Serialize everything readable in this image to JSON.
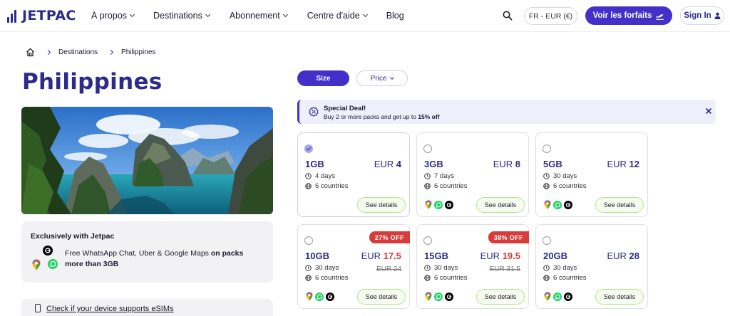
{
  "header": {
    "logo": "JETPAC",
    "nav": [
      {
        "label": "À propos",
        "dropdown": true
      },
      {
        "label": "Destinations",
        "dropdown": true
      },
      {
        "label": "Abonnement",
        "dropdown": true
      },
      {
        "label": "Centre d'aide",
        "dropdown": true
      },
      {
        "label": "Blog",
        "dropdown": false
      }
    ],
    "lang_currency": "FR - EUR (€)",
    "cta_label": "Voir les forfaits",
    "signin_label": "Sign In"
  },
  "breadcrumb": [
    "Destinations",
    "Philippines"
  ],
  "page_title": "Philippines",
  "exclusive": {
    "title": "Exclusively with Jetpac",
    "text_plain": "Free WhatsApp Chat, Uber & Google Maps ",
    "text_bold": "on packs more than 3GB"
  },
  "device_check": "Check if your device supports eSIMs",
  "filters": {
    "size": "Size",
    "price": "Price"
  },
  "deal": {
    "title": "Special Deal!",
    "text": "Buy 2 or more packs and get up to ",
    "highlight": "15% off"
  },
  "details_label": "See details",
  "plans": [
    {
      "data": "1GB",
      "currency": "EUR",
      "price": "4",
      "days": "4 days",
      "countries": "6 countries",
      "selected": true,
      "apps": false
    },
    {
      "data": "3GB",
      "currency": "EUR",
      "price": "8",
      "days": "7 days",
      "countries": "6 countries",
      "selected": false,
      "apps": true
    },
    {
      "data": "5GB",
      "currency": "EUR",
      "price": "12",
      "days": "30 days",
      "countries": "6 countries",
      "selected": false,
      "apps": true
    },
    {
      "data": "10GB",
      "currency": "EUR",
      "price": "17.5",
      "old_price": "EUR 24",
      "badge": "27% OFF",
      "days": "30 days",
      "countries": "6 countries",
      "selected": false,
      "apps": true
    },
    {
      "data": "15GB",
      "currency": "EUR",
      "price": "19.5",
      "old_price": "EUR 31.5",
      "badge": "38% OFF",
      "days": "30 days",
      "countries": "6 countries",
      "selected": false,
      "apps": true
    },
    {
      "data": "20GB",
      "currency": "EUR",
      "price": "28",
      "days": "30 days",
      "countries": "6 countries",
      "selected": false,
      "apps": true
    }
  ],
  "colors": {
    "brand": "#2e2a8a",
    "accent": "#4430c9",
    "sale": "#d83b3b",
    "details_border": "#b8e28e"
  }
}
